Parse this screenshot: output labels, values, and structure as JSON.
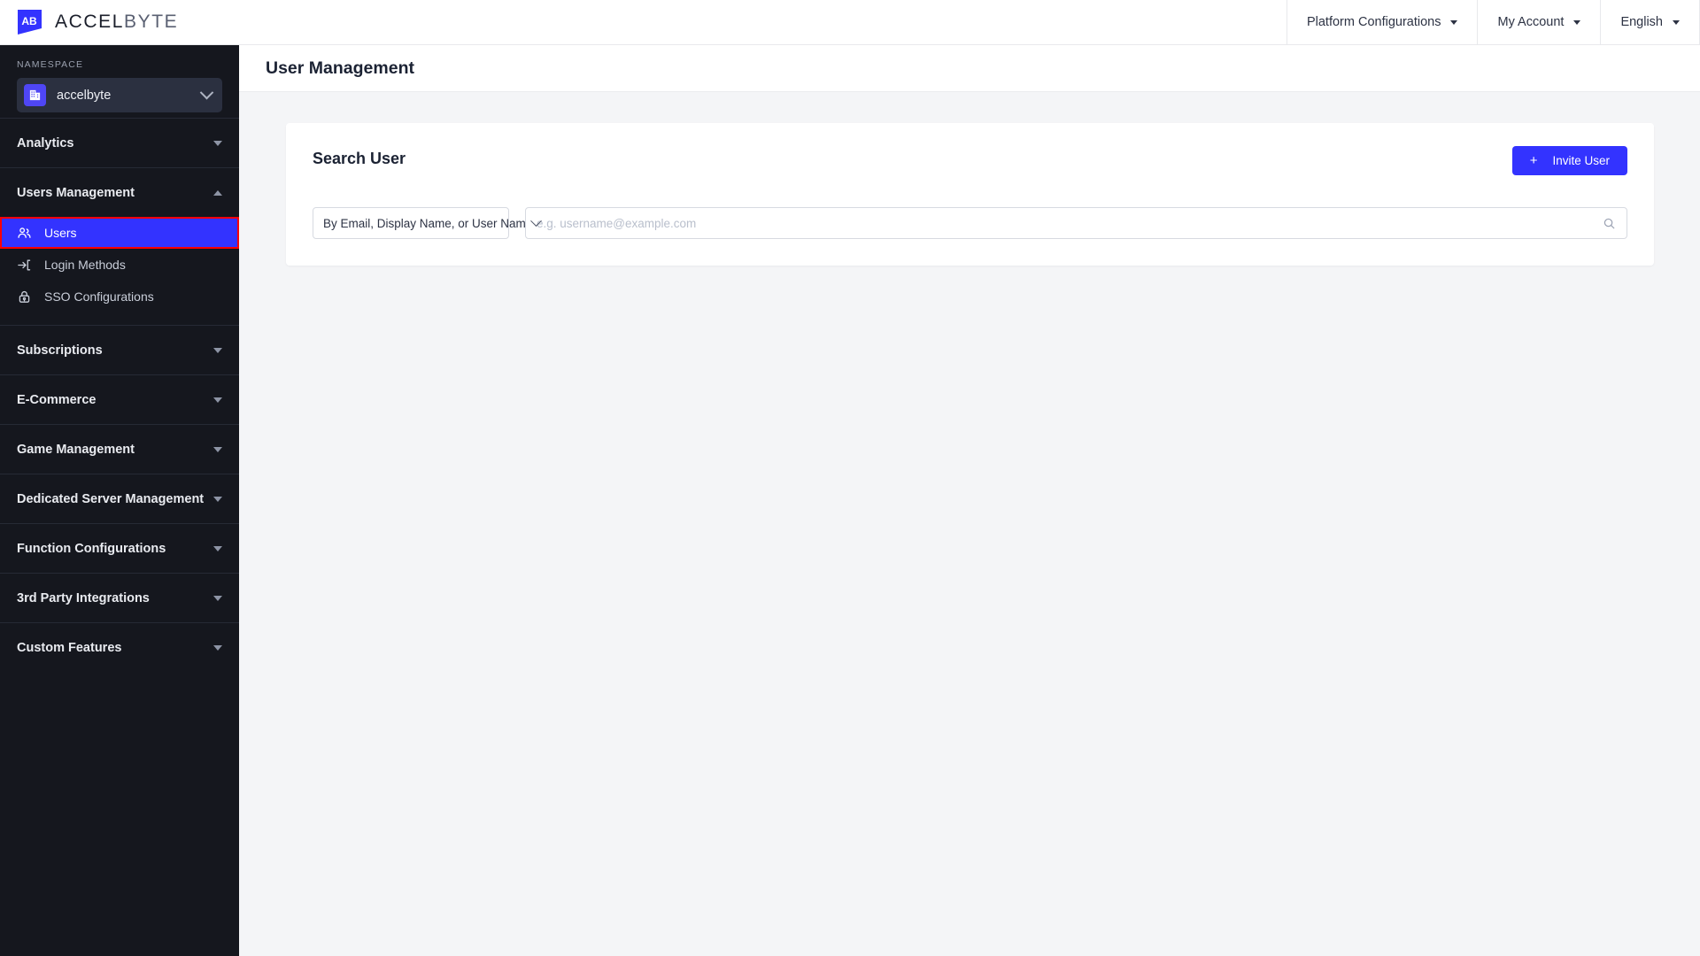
{
  "topbar": {
    "logo_text_bold": "ACCEL",
    "logo_text_light": "BYTE",
    "logo_mark": "accelbyte-logo-icon",
    "nav": [
      {
        "label": "Platform Configurations",
        "icon": "chevron-down-icon"
      },
      {
        "label": "My Account",
        "icon": "chevron-down-icon"
      },
      {
        "label": "English",
        "icon": "chevron-down-icon"
      }
    ]
  },
  "sidebar": {
    "namespace_label": "NAMESPACE",
    "namespace_value": "accelbyte",
    "namespace_icon": "building-icon",
    "namespace_chevron": "chevron-down-icon",
    "sections": [
      {
        "label": "Analytics",
        "expanded": false,
        "items": []
      },
      {
        "label": "Users Management",
        "expanded": true,
        "items": [
          {
            "label": "Users",
            "icon": "users-icon",
            "active": true
          },
          {
            "label": "Login Methods",
            "icon": "login-arrow-icon",
            "active": false
          },
          {
            "label": "SSO Configurations",
            "icon": "lock-icon",
            "active": false
          }
        ]
      },
      {
        "label": "Subscriptions",
        "expanded": false,
        "items": []
      },
      {
        "label": "E-Commerce",
        "expanded": false,
        "items": []
      },
      {
        "label": "Game Management",
        "expanded": false,
        "items": []
      },
      {
        "label": "Dedicated Server Management",
        "expanded": false,
        "items": []
      },
      {
        "label": "Function Configurations",
        "expanded": false,
        "items": []
      },
      {
        "label": "3rd Party Integrations",
        "expanded": false,
        "items": []
      },
      {
        "label": "Custom Features",
        "expanded": false,
        "items": []
      }
    ]
  },
  "page": {
    "title": "User Management"
  },
  "card": {
    "title": "Search User",
    "invite_button": {
      "label": "Invite User",
      "plus": "+",
      "icon": "plus-icon"
    },
    "filter_select": {
      "value": "By Email, Display Name, or User Name",
      "icon": "chevron-down-icon"
    },
    "search_field": {
      "value": "",
      "placeholder": "e.g. username@example.com",
      "icon": "search-icon"
    }
  },
  "colors": {
    "accent": "#3333ff",
    "sidebar_bg": "#15171e",
    "namespace_bg": "#2b3040",
    "page_bg": "#f4f5f7",
    "card_bg": "#ffffff",
    "highlight_border": "#ff0000",
    "text_dark": "#1b2233"
  }
}
